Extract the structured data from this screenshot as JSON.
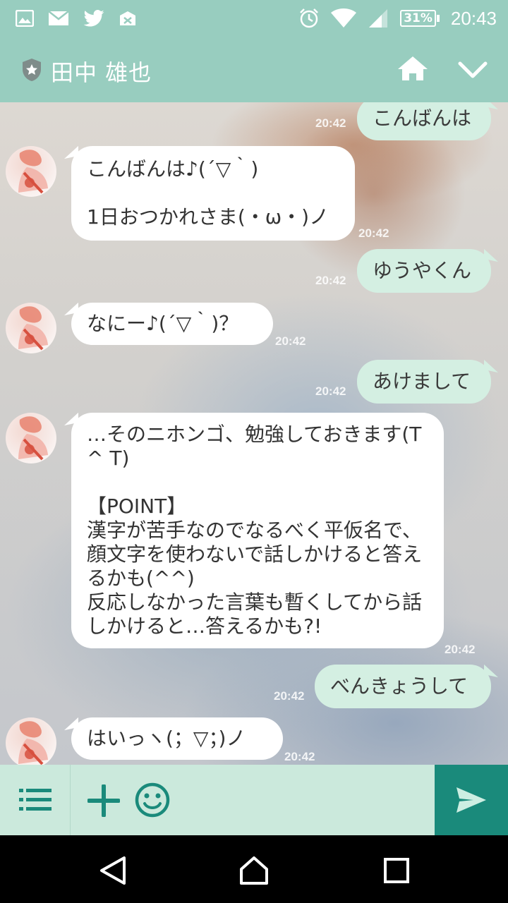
{
  "status_bar": {
    "icons_left": [
      "image-icon",
      "mail-icon",
      "twitter-icon",
      "mail-x-icon"
    ],
    "icons_right": [
      "alarm-icon",
      "wifi-icon",
      "signal-icon"
    ],
    "battery": "31%",
    "time": "20:43"
  },
  "header": {
    "title": "田中 雄也",
    "badge_icon": "shield-star-icon",
    "home_icon": "home-icon",
    "menu_icon": "chevron-down-icon"
  },
  "messages": [
    {
      "side": "out",
      "text": "こんばんは",
      "time": "20:42"
    },
    {
      "side": "in",
      "text": "こんばんは♪(´▽｀)\n\n1日おつかれさま(・ω・)ノ",
      "time": "20:42"
    },
    {
      "side": "out",
      "text": "ゆうやくん",
      "time": "20:42"
    },
    {
      "side": "in",
      "text": "なにー♪(´▽｀)？",
      "time": "20:42"
    },
    {
      "side": "out",
      "text": "あけまして",
      "time": "20:42"
    },
    {
      "side": "in",
      "text": "…そのニホンゴ、勉強しておきます(T ^ T)\n\n【POINT】\n漢字が苦手なのでなるべく平仮名で、顔文字を使わないで話しかけると答えるかも(^^)\n反応しなかった言葉も暫くしてから話しかけると…答えるかも?!",
      "time": "20:42"
    },
    {
      "side": "out",
      "text": "べんきょうして",
      "time": "20:42"
    },
    {
      "side": "in",
      "text": "はいっヽ(；▽；)ノ",
      "time": "20:42"
    }
  ],
  "input_bar": {
    "menu_icon": "list-icon",
    "plus_icon": "plus-icon",
    "emoji_icon": "smiley-icon",
    "text_value": "",
    "send_icon": "send-icon"
  },
  "nav_bar": [
    "back-icon",
    "home-icon",
    "recents-icon"
  ],
  "colors": {
    "accent": "#98cdbf",
    "send": "#1a8a7b",
    "bubble_out": "#d4efe2",
    "bubble_in": "#ffffff"
  }
}
